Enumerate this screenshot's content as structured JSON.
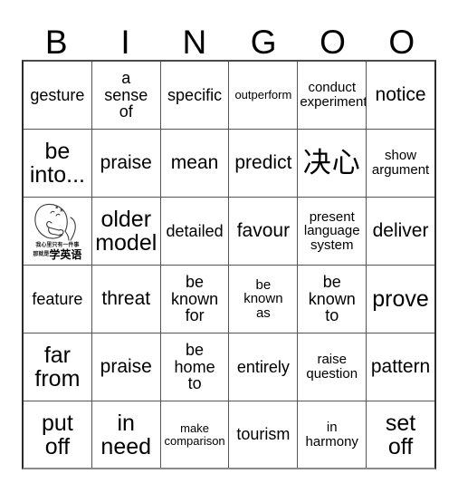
{
  "card": {
    "header_letters": [
      "B",
      "I",
      "N",
      "G",
      "O",
      "O"
    ],
    "rows": [
      [
        {
          "text": "gesture",
          "size": "fs-md"
        },
        {
          "text": "a\nsense\nof",
          "size": "fs-md"
        },
        {
          "text": "specific",
          "size": "fs-md"
        },
        {
          "text": "outperform",
          "size": "fs-xs"
        },
        {
          "text": "conduct\nexperiment",
          "size": "fs-sm"
        },
        {
          "text": "notice",
          "size": "fs-lg"
        }
      ],
      [
        {
          "text": "be\ninto...",
          "size": "fs-xl"
        },
        {
          "text": "praise",
          "size": "fs-lg"
        },
        {
          "text": "mean",
          "size": "fs-lg"
        },
        {
          "text": "predict",
          "size": "fs-lg"
        },
        {
          "text": "决心",
          "size": "fs-cjk"
        },
        {
          "text": "show\nargument",
          "size": "fs-sm"
        }
      ],
      [
        {
          "type": "image",
          "image_name": "study-english-meme",
          "caption_line1": "我心里只有一件事",
          "caption_line2_small": "那就是",
          "caption_line2_big": "学英语"
        },
        {
          "text": "older\nmodel",
          "size": "fs-xl"
        },
        {
          "text": "detailed",
          "size": "fs-md"
        },
        {
          "text": "favour",
          "size": "fs-lg"
        },
        {
          "text": "present\nlanguage\nsystem",
          "size": "fs-sm"
        },
        {
          "text": "deliver",
          "size": "fs-lg"
        }
      ],
      [
        {
          "text": "feature",
          "size": "fs-md"
        },
        {
          "text": "threat",
          "size": "fs-lg"
        },
        {
          "text": "be\nknown\nfor",
          "size": "fs-md"
        },
        {
          "text": "be\nknown\nas",
          "size": "fs-sm"
        },
        {
          "text": "be\nknown\nto",
          "size": "fs-md"
        },
        {
          "text": "prove",
          "size": "fs-xl"
        }
      ],
      [
        {
          "text": "far\nfrom",
          "size": "fs-xl"
        },
        {
          "text": "praise",
          "size": "fs-lg"
        },
        {
          "text": "be\nhome\nto",
          "size": "fs-md"
        },
        {
          "text": "entirely",
          "size": "fs-md"
        },
        {
          "text": "raise\nquestion",
          "size": "fs-sm"
        },
        {
          "text": "pattern",
          "size": "fs-lg"
        }
      ],
      [
        {
          "text": "put\noff",
          "size": "fs-xl"
        },
        {
          "text": "in\nneed",
          "size": "fs-xl"
        },
        {
          "text": "make\ncomparison",
          "size": "fs-xs"
        },
        {
          "text": "tourism",
          "size": "fs-md"
        },
        {
          "text": "in\nharmony",
          "size": "fs-sm"
        },
        {
          "text": "set\noff",
          "size": "fs-xl"
        }
      ]
    ]
  },
  "colors": {
    "background": "#ffffff",
    "text": "#000000",
    "grid_line": "#555555",
    "grid_outer": "#2b2b2b"
  }
}
